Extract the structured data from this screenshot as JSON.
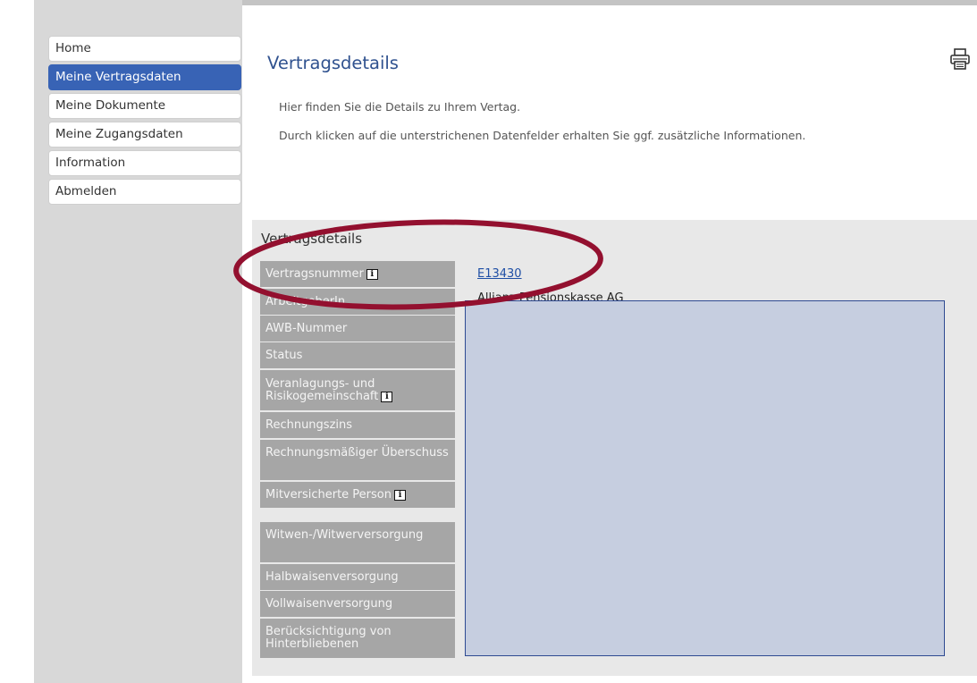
{
  "nav": {
    "items": [
      {
        "label": "Home",
        "active": false
      },
      {
        "label": "Meine Vertragsdaten",
        "active": true
      },
      {
        "label": "Meine Dokumente",
        "active": false
      },
      {
        "label": "Meine Zugangsdaten",
        "active": false
      },
      {
        "label": "Information",
        "active": false
      },
      {
        "label": "Abmelden",
        "active": false
      }
    ]
  },
  "main": {
    "title": "Vertragsdetails",
    "intro_1": "Hier finden Sie die Details zu Ihrem Vertag.",
    "intro_2": "Durch klicken auf die unterstrichenen Datenfelder erhalten Sie ggf. zusätzliche Informationen."
  },
  "details": {
    "section_title": "Vertragsdetails",
    "info_glyph": "i",
    "labels": [
      "Vertragsnummer",
      "ArbeitgeberIn",
      "AWB-Nummer",
      "Status",
      "Veranlagungs- und Risikogemeinschaft",
      "Rechnungszins",
      "Rechnungsmäßiger Überschuss",
      "Mitversicherte Person",
      "Witwen-/Witwerversorgung",
      "Halbwaisenversorgung",
      "Vollwaisenversorgung",
      "Berücksichtigung von Hinterbliebenen"
    ],
    "values": {
      "contract_number": "E13430",
      "employer": "Allianz Pensionskasse AG"
    }
  },
  "colors": {
    "nav_active": "#3863b5",
    "title": "#30528f",
    "label_bg": "#a6a6a6",
    "redaction_fill": "#c6cee0",
    "redaction_border": "#2e4a92",
    "highlight_ellipse": "#93102f"
  },
  "icons": [
    "printer-icon",
    "info-icon"
  ]
}
